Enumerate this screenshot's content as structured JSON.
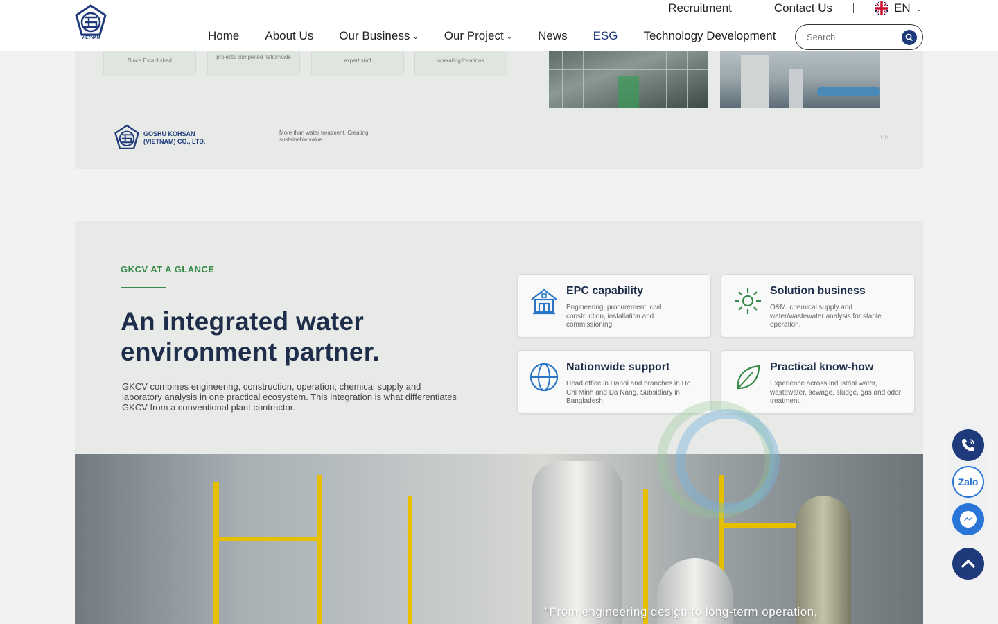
{
  "brand": {
    "logo_label": "VIETNAM"
  },
  "topbar": {
    "recruitment": "Recruitment",
    "contact": "Contact Us",
    "language": "EN"
  },
  "nav": {
    "items": [
      {
        "label": "Home"
      },
      {
        "label": "About Us"
      },
      {
        "label": "Our Business"
      },
      {
        "label": "Our Project"
      },
      {
        "label": "News"
      },
      {
        "label": "ESG"
      },
      {
        "label": "Technology Development"
      }
    ]
  },
  "search": {
    "placeholder": "Search"
  },
  "slide1": {
    "stats": [
      "Since Established",
      "projects completed nationwide",
      "expert staff",
      "operating locations"
    ],
    "company": "GOSHU KOHSAN (VIETNAM) CO., LTD.",
    "tagline": "More than water treatment. Creating sustainable value.",
    "page_num": "05"
  },
  "glance": {
    "eyebrow": "GKCV AT A GLANCE",
    "headline": "An integrated water environment partner.",
    "description": "GKCV combines engineering, construction, operation, chemical supply and laboratory analysis in one practical ecosystem. This integration is what differentiates GKCV from a conventional plant contractor.",
    "cards": [
      {
        "title": "EPC capability",
        "text": "Engineering, procurement, civil construction, installation and commissioning."
      },
      {
        "title": "Solution business",
        "text": "O&M, chemical supply and water/wastewater analysis for stable operation."
      },
      {
        "title": "Nationwide support",
        "text": "Head office in Hanoi and branches in Ho Chi Minh and Da Nang. Subsidiary in Bangladesh"
      },
      {
        "title": "Practical know-how",
        "text": "Experience across industrial water, wastewater, sewage, sludge, gas and odor treatment."
      }
    ]
  },
  "banner": {
    "quote": "\"From engineering design to long-term operation,"
  },
  "floating": {
    "zalo": "Zalo"
  },
  "colors": {
    "brand": "#1f3a7a",
    "accent_green": "#3a8a4a"
  }
}
